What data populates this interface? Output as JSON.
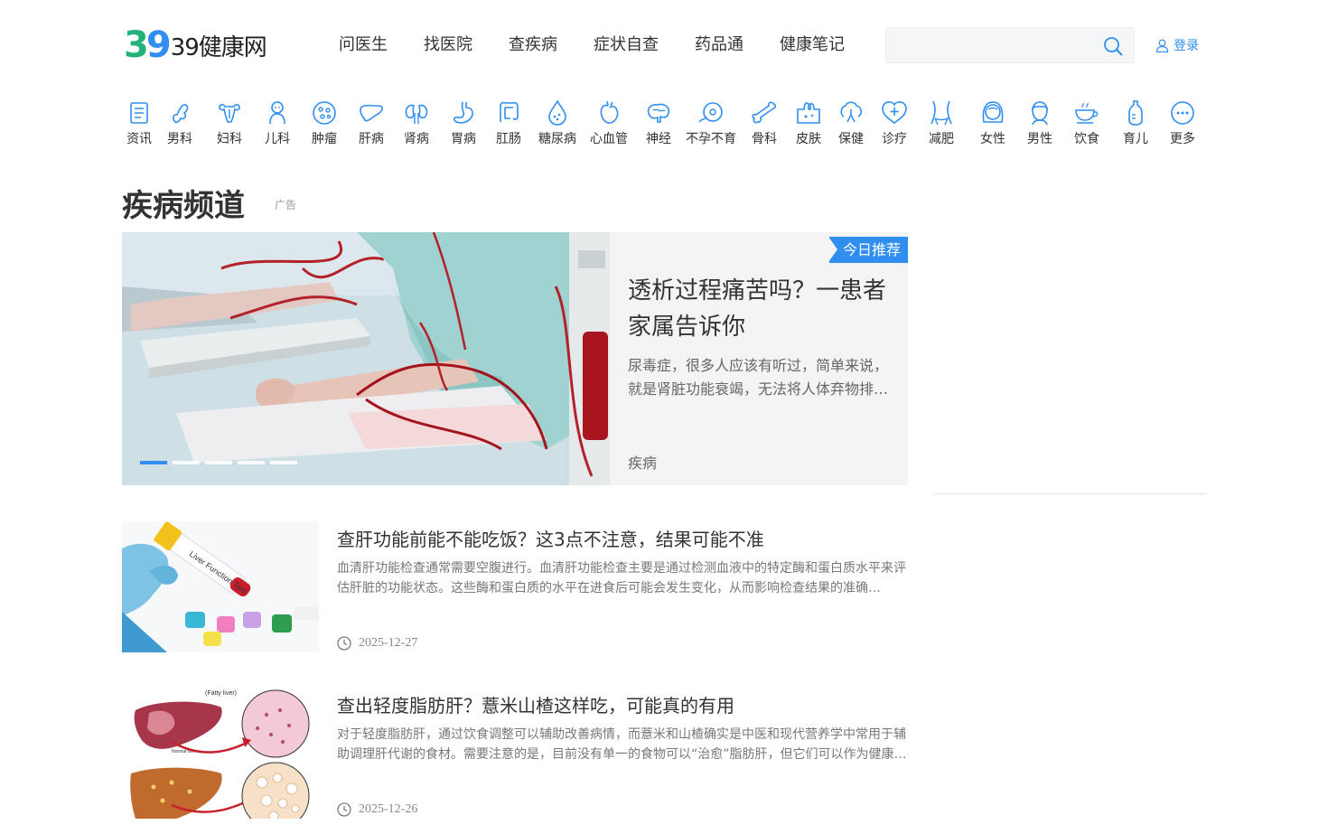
{
  "logo": {
    "mark": "39",
    "text": "39健康网"
  },
  "topnav": [
    "问医生",
    "找医院",
    "查疾病",
    "症状自查",
    "药品通",
    "健康笔记"
  ],
  "search": {
    "placeholder": "",
    "value": ""
  },
  "login": {
    "label": "登录"
  },
  "categories": [
    {
      "label": "资讯",
      "icon": "news-icon"
    },
    {
      "label": "男科",
      "icon": "male-organ-icon"
    },
    {
      "label": "妇科",
      "icon": "uterus-icon"
    },
    {
      "label": "儿科",
      "icon": "baby-icon"
    },
    {
      "label": "肿瘤",
      "icon": "tumor-cell-icon"
    },
    {
      "label": "肝病",
      "icon": "liver-icon"
    },
    {
      "label": "肾病",
      "icon": "kidney-icon"
    },
    {
      "label": "胃病",
      "icon": "stomach-icon"
    },
    {
      "label": "肛肠",
      "icon": "intestine-icon"
    },
    {
      "label": "糖尿病",
      "icon": "blood-drop-icon"
    },
    {
      "label": "心血管",
      "icon": "heart-icon"
    },
    {
      "label": "神经",
      "icon": "brain-icon"
    },
    {
      "label": "不孕不育",
      "icon": "sperm-egg-icon"
    },
    {
      "label": "骨科",
      "icon": "bone-icon"
    },
    {
      "label": "皮肤",
      "icon": "skin-icon"
    },
    {
      "label": "保健",
      "icon": "health-care-icon"
    },
    {
      "label": "诊疗",
      "icon": "medical-cross-icon"
    },
    {
      "label": "减肥",
      "icon": "waist-icon"
    },
    {
      "label": "女性",
      "icon": "woman-face-icon"
    },
    {
      "label": "男性",
      "icon": "man-face-icon"
    },
    {
      "label": "饮食",
      "icon": "cup-icon"
    },
    {
      "label": "育儿",
      "icon": "baby-bottle-icon"
    },
    {
      "label": "更多",
      "icon": "more-icon"
    }
  ],
  "section": {
    "title": "疾病频道",
    "ad_label": "广告"
  },
  "hero": {
    "badge": "今日推荐",
    "title": "透析过程痛苦吗？一患者家属告诉你",
    "desc": "尿毒症，很多人应该有听过，简单来说，就是肾脏功能衰竭，无法将人体弃物排出体外……",
    "tag": "疾病",
    "slides": 5,
    "active_slide": 1
  },
  "articles": [
    {
      "title": "查肝功能前能不能吃饭？这3点不注意，结果可能不准",
      "desc": "血清肝功能检查通常需要空腹进行。血清肝功能检查主要是通过检测血液中的特定酶和蛋白质水平来评估肝脏的功能状态。这些酶和蛋白质的水平在进食后可能会发生变化，从而影响检查结果的准确性。……",
      "date": "2025-12-27",
      "image_label": "Liver Function Test"
    },
    {
      "title": "查出轻度脂肪肝？薏米山楂这样吃，可能真的有用",
      "desc": "对于轻度脂肪肝，通过饮食调整可以辅助改善病情，而薏米和山楂确实是中医和现代营养学中常用于辅助调理肝代谢的食材。需要注意的是，目前没有单一的食物可以“治愈”脂肪肝，但它们可以作为健康饮食的一部分……",
      "date": "2025-12-26",
      "image_label": "(Fatty liver)",
      "image_label2": "Normal liver"
    }
  ],
  "colors": {
    "accent": "#2f8ef0",
    "logo_green": "#23b27a"
  }
}
